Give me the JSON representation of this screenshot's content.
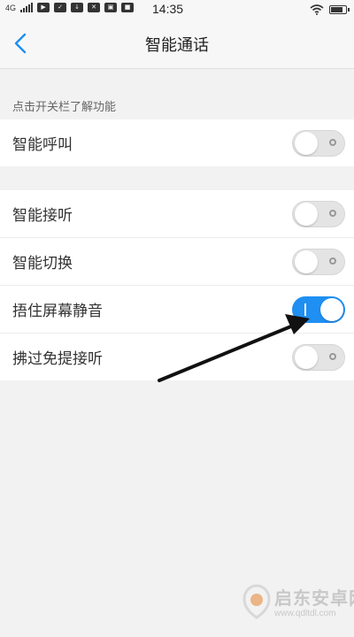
{
  "status_bar": {
    "network": "4G",
    "time": "14:35"
  },
  "header": {
    "title": "智能通话",
    "back_icon": "chevron-left-icon"
  },
  "section_hint": "点击开关栏了解功能",
  "group1": [
    {
      "label": "智能呼叫",
      "toggle": "off"
    }
  ],
  "group2": [
    {
      "label": "智能接听",
      "toggle": "off"
    },
    {
      "label": "智能切换",
      "toggle": "off"
    },
    {
      "label": "捂住屏幕静音",
      "toggle": "on"
    },
    {
      "label": "拂过免提接听",
      "toggle": "off"
    }
  ],
  "colors": {
    "accent": "#1f8ff2",
    "toggle_off": "#e4e4e4",
    "background": "#f2f2f2"
  },
  "watermark": {
    "title": "启东安卓网",
    "url": "www.qdltdl.com"
  }
}
